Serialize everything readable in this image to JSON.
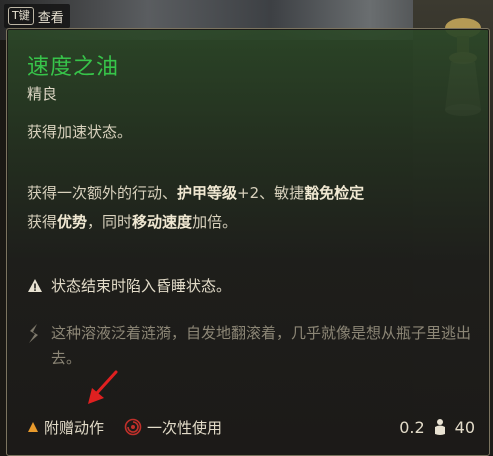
{
  "hotkey": {
    "key": "T键",
    "label": "查看"
  },
  "item": {
    "name": "速度之油",
    "rarity": "精良",
    "short_desc": "获得加速状态。",
    "effect": {
      "p1": "获得一次额外的行动、",
      "b1": "护甲等级",
      "p2": "+2、敏捷",
      "b2": "豁免检定",
      "p3": "获得",
      "b3": "优势",
      "p4": "，同时",
      "b4": "移动速度",
      "p5": "加倍。"
    },
    "warning": "状态结束时陷入昏睡状态。",
    "flavor": "这种溶液泛着涟漪，自发地翻滚着，几乎就像是想从瓶子里逃出去。"
  },
  "footer": {
    "action_type": "附赠动作",
    "usage": "一次性使用",
    "weight": "0.2",
    "price": "40"
  },
  "colors": {
    "title": "#37c44a",
    "text": "#d8d1bd",
    "flavor": "#8c8676",
    "annotation_arrow": "#e02020"
  },
  "icons": {
    "warning": "warning-icon",
    "flavor": "flavor-text-icon",
    "bonus_action": "bonus-action-icon",
    "one_time": "one-time-use-icon",
    "price": "gold-coin-icon",
    "lamp": "lamp-icon"
  }
}
